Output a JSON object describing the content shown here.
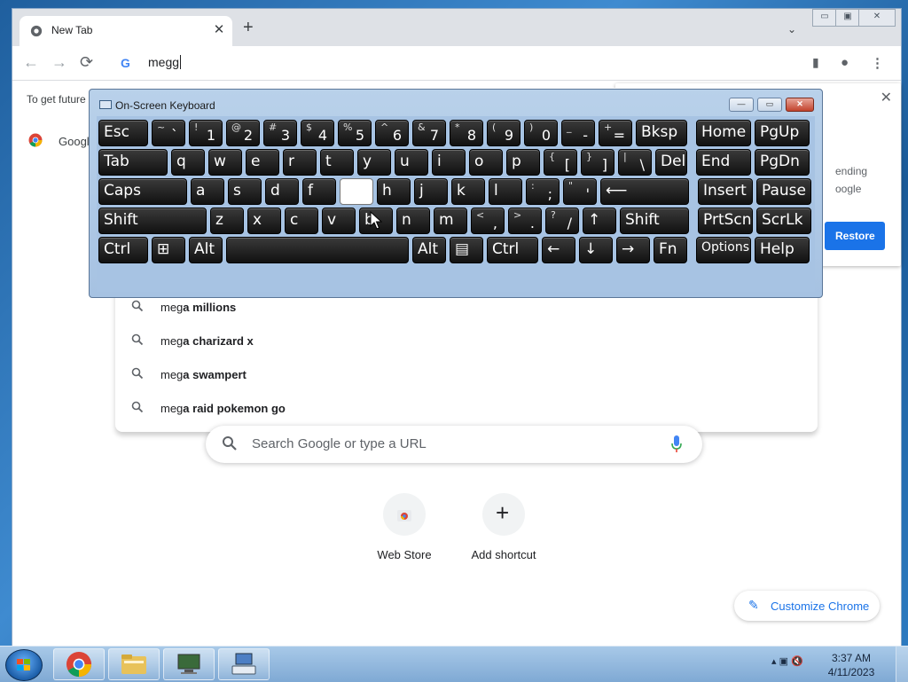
{
  "chrome": {
    "tab_title": "New Tab",
    "tab_close": "✕",
    "new_tab": "+",
    "tab_search": "⌄",
    "window_controls": [
      "▭",
      "▣",
      "✕"
    ],
    "nav": {
      "back": "←",
      "forward": "→",
      "reload": "⟳"
    },
    "omnibox_value": "megg",
    "menu": "⋮"
  },
  "background_page": {
    "left_text": "To get future",
    "left_item": "Googl",
    "restore_line1": "ending",
    "restore_line2": "oogle",
    "restore_button": "Restore",
    "restore_close": "✕"
  },
  "suggestions": [
    {
      "prefix": "meg",
      "rest": "a millions"
    },
    {
      "prefix": "meg",
      "rest": "a charizard x"
    },
    {
      "prefix": "meg",
      "rest": "a swampert"
    },
    {
      "prefix": "meg",
      "rest": "a raid pokemon go"
    }
  ],
  "ntp": {
    "search_placeholder": "Search Google or type a URL",
    "shortcuts": [
      {
        "label": "Web Store",
        "icon": "webstore-icon"
      },
      {
        "label": "Add shortcut",
        "icon": "plus-icon"
      }
    ],
    "customize_label": "Customize Chrome"
  },
  "osk": {
    "title": "On-Screen Keyboard",
    "rows": [
      [
        {
          "m": "Esc",
          "w": 58
        },
        {
          "s": "~",
          "b": "`",
          "w": 40
        },
        {
          "s": "!",
          "b": "1",
          "w": 40
        },
        {
          "s": "@",
          "b": "2",
          "w": 40
        },
        {
          "s": "#",
          "b": "3",
          "w": 40
        },
        {
          "s": "$",
          "b": "4",
          "w": 40
        },
        {
          "s": "%",
          "b": "5",
          "w": 40
        },
        {
          "s": "^",
          "b": "6",
          "w": 40
        },
        {
          "s": "&",
          "b": "7",
          "w": 40
        },
        {
          "s": "*",
          "b": "8",
          "w": 40
        },
        {
          "s": "(",
          "b": "9",
          "w": 40
        },
        {
          "s": ")",
          "b": "0",
          "w": 40
        },
        {
          "s": "_",
          "b": "-",
          "w": 40
        },
        {
          "s": "+",
          "b": "=",
          "w": 40
        },
        {
          "m": "Bksp",
          "w": 60
        },
        {
          "gap": 6
        },
        {
          "m": "Home",
          "w": 64
        },
        {
          "m": "PgUp",
          "w": 64
        }
      ],
      [
        {
          "m": "Tab",
          "w": 80
        },
        {
          "m": "q",
          "w": 40
        },
        {
          "m": "w",
          "w": 40
        },
        {
          "m": "e",
          "w": 40
        },
        {
          "m": "r",
          "w": 40
        },
        {
          "m": "t",
          "w": 40
        },
        {
          "m": "y",
          "w": 40
        },
        {
          "m": "u",
          "w": 40
        },
        {
          "m": "i",
          "w": 40
        },
        {
          "m": "o",
          "w": 40
        },
        {
          "m": "p",
          "w": 40
        },
        {
          "s": "{",
          "b": "[",
          "w": 40
        },
        {
          "s": "}",
          "b": "]",
          "w": 40
        },
        {
          "s": "|",
          "b": "\\",
          "w": 40
        },
        {
          "m": "Del",
          "w": 38
        },
        {
          "gap": 6
        },
        {
          "m": "End",
          "w": 64
        },
        {
          "m": "PgDn",
          "w": 64
        }
      ],
      [
        {
          "m": "Caps",
          "w": 102
        },
        {
          "m": "a",
          "w": 40
        },
        {
          "m": "s",
          "w": 40
        },
        {
          "m": "d",
          "w": 40
        },
        {
          "m": "f",
          "w": 40
        },
        {
          "m": "",
          "w": 40,
          "white": true
        },
        {
          "m": "h",
          "w": 40
        },
        {
          "m": "j",
          "w": 40
        },
        {
          "m": "k",
          "w": 40
        },
        {
          "m": "l",
          "w": 40
        },
        {
          "s": ":",
          "b": ";",
          "w": 40
        },
        {
          "s": "\"",
          "b": "'",
          "w": 40
        },
        {
          "m": "⟵",
          "w": 102
        },
        {
          "gap": 6
        },
        {
          "m": "Insert",
          "w": 64
        },
        {
          "m": "Pause",
          "w": 64
        }
      ],
      [
        {
          "m": "Shift",
          "w": 124
        },
        {
          "m": "z",
          "w": 40
        },
        {
          "m": "x",
          "w": 40
        },
        {
          "m": "c",
          "w": 40
        },
        {
          "m": "v",
          "w": 40
        },
        {
          "m": "b",
          "w": 40
        },
        {
          "m": "n",
          "w": 40
        },
        {
          "m": "m",
          "w": 40
        },
        {
          "s": "<",
          "b": ",",
          "w": 40
        },
        {
          "s": ">",
          "b": ".",
          "w": 40
        },
        {
          "s": "?",
          "b": "/",
          "w": 40
        },
        {
          "m": "↑",
          "w": 40
        },
        {
          "m": "Shift",
          "w": 80
        },
        {
          "gap": 6
        },
        {
          "m": "PrtScn",
          "w": 64
        },
        {
          "m": "ScrLk",
          "w": 64
        }
      ],
      [
        {
          "m": "Ctrl",
          "w": 58
        },
        {
          "m": "⊞",
          "w": 40
        },
        {
          "m": "Alt",
          "w": 40
        },
        {
          "m": "",
          "w": 208
        },
        {
          "m": "Alt",
          "w": 40
        },
        {
          "m": "▤",
          "w": 40
        },
        {
          "m": "Ctrl",
          "w": 60
        },
        {
          "m": "←",
          "w": 40
        },
        {
          "m": "↓",
          "w": 40
        },
        {
          "m": "→",
          "w": 40
        },
        {
          "m": "Fn",
          "w": 40
        },
        {
          "gap": 6
        },
        {
          "m": "Options",
          "w": 64,
          "small": true
        },
        {
          "m": "Help",
          "w": 64
        }
      ]
    ]
  },
  "taskbar": {
    "time": "3:37 AM",
    "date": "4/11/2023",
    "tray": "▴  ▣  🔇"
  }
}
